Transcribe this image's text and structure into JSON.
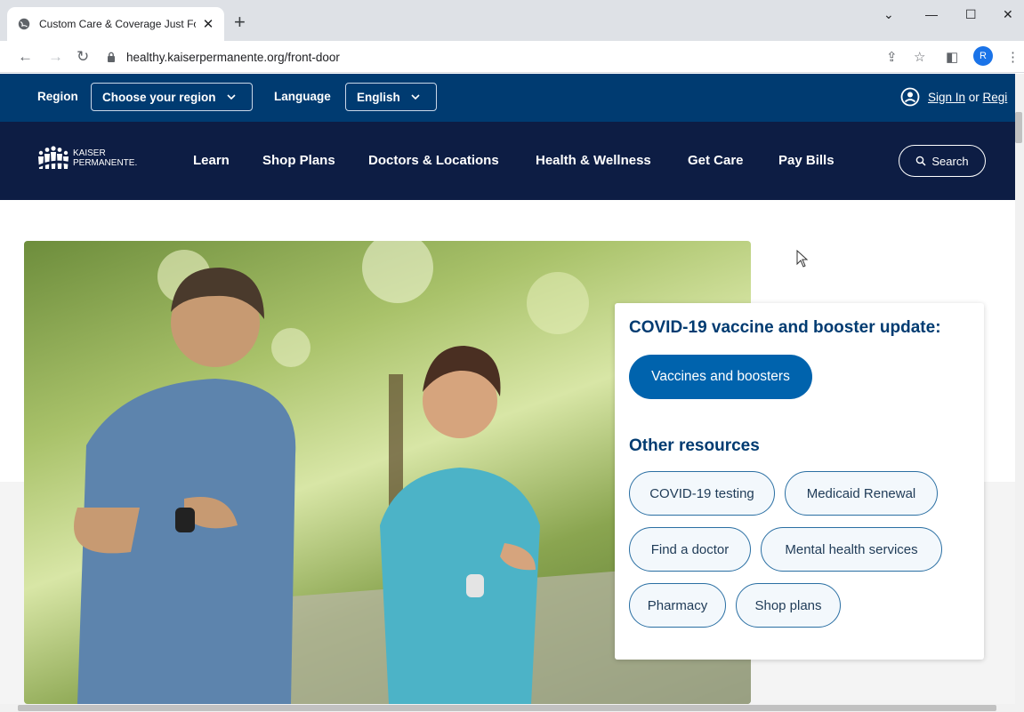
{
  "browser": {
    "tab_title": "Custom Care & Coverage Just Fo",
    "tab_close": "✕",
    "new_tab": "+",
    "url": "healthy.kaiserpermanente.org/front-door",
    "profile_initial": "R"
  },
  "utility_bar": {
    "region_label": "Region",
    "region_value": "Choose your region",
    "language_label": "Language",
    "language_value": "English",
    "sign_in": "Sign In",
    "or_text": " or ",
    "register": "Regi"
  },
  "brand": {
    "logo_line1": "KAISER",
    "logo_line2": "PERMANENTE."
  },
  "nav": {
    "items": [
      "Learn",
      "Shop Plans",
      "Doctors & Locations",
      "Health & Wellness",
      "Get Care",
      "Pay Bills"
    ],
    "search": "Search"
  },
  "card": {
    "title": "COVID-19 vaccine and booster update:",
    "primary_button": "Vaccines and boosters",
    "subtitle": "Other resources",
    "resources": [
      "COVID-19 testing",
      "Medicaid Renewal",
      "Find a doctor",
      "Mental health services",
      "Pharmacy",
      "Shop plans"
    ]
  },
  "icons": {
    "globe": "globe-icon",
    "lock": "lock-icon",
    "user": "user-circle-icon",
    "search": "search-icon"
  },
  "colors": {
    "utility_bg": "#003b71",
    "nav_bg": "#0d1d44",
    "primary": "#0063ad",
    "heading": "#003b71"
  }
}
